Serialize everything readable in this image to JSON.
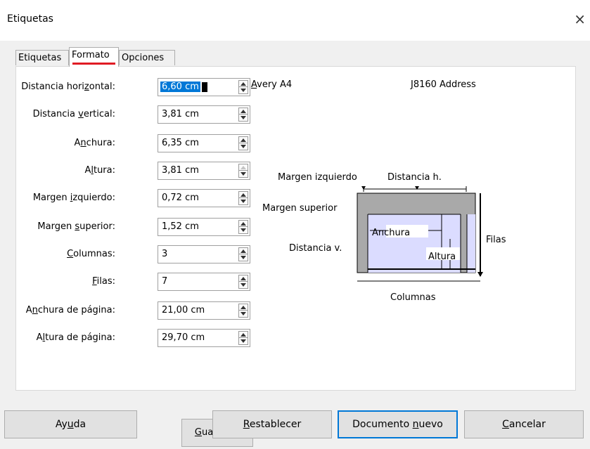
{
  "window": {
    "title": "Etiquetas",
    "close_label": "×"
  },
  "tabs": [
    {
      "label": "Etiquetas"
    },
    {
      "label": "Formato"
    },
    {
      "label": "Opciones"
    }
  ],
  "fields": [
    {
      "label_pre": "Distancia hori",
      "label_key": "z",
      "label_post": "ontal:",
      "value": "6,60 cm"
    },
    {
      "label_pre": "Distancia ",
      "label_key": "v",
      "label_post": "ertical:",
      "value": "3,81 cm"
    },
    {
      "label_pre": "A",
      "label_key": "n",
      "label_post": "chura:",
      "value": "6,35 cm"
    },
    {
      "label_pre": "A",
      "label_key": "l",
      "label_post": "tura:",
      "value": "3,81 cm"
    },
    {
      "label_pre": "Margen ",
      "label_key": "i",
      "label_post": "zquierdo:",
      "value": "0,72 cm"
    },
    {
      "label_pre": "Margen ",
      "label_key": "s",
      "label_post": "uperior:",
      "value": "1,52 cm"
    },
    {
      "label_pre": "",
      "label_key": "C",
      "label_post": "olumnas:",
      "value": "3"
    },
    {
      "label_pre": "",
      "label_key": "F",
      "label_post": "ilas:",
      "value": "7"
    },
    {
      "label_pre": "A",
      "label_key": "n",
      "label_post": "chura de página:",
      "value": "21,00 cm"
    },
    {
      "label_pre": "A",
      "label_key": "l",
      "label_post": "tura de página:",
      "value": "29,70 cm"
    }
  ],
  "save_button": {
    "pre": "",
    "key": "G",
    "post": "uardar..."
  },
  "brand": {
    "pre": "",
    "key": "A",
    "post": "very A4"
  },
  "product": {
    "pre": "",
    "key": "J",
    "post": "8160 Address"
  },
  "diagram": {
    "margen_izquierdo": "Margen izquierdo",
    "distancia_h": "Distancia h.",
    "margen_superior": "Margen superior",
    "distancia_v": "Distancia v.",
    "anchura": "Anchura",
    "altura": "Altura",
    "filas": "Filas",
    "columnas": "Columnas"
  },
  "footer": {
    "help": {
      "pre": "Ay",
      "key": "u",
      "post": "da"
    },
    "reset": {
      "pre": "",
      "key": "R",
      "post": "establecer"
    },
    "new_doc": {
      "pre": "Documento ",
      "key": "n",
      "post": "uevo"
    },
    "cancel": {
      "pre": "",
      "key": "C",
      "post": "ancelar"
    }
  }
}
